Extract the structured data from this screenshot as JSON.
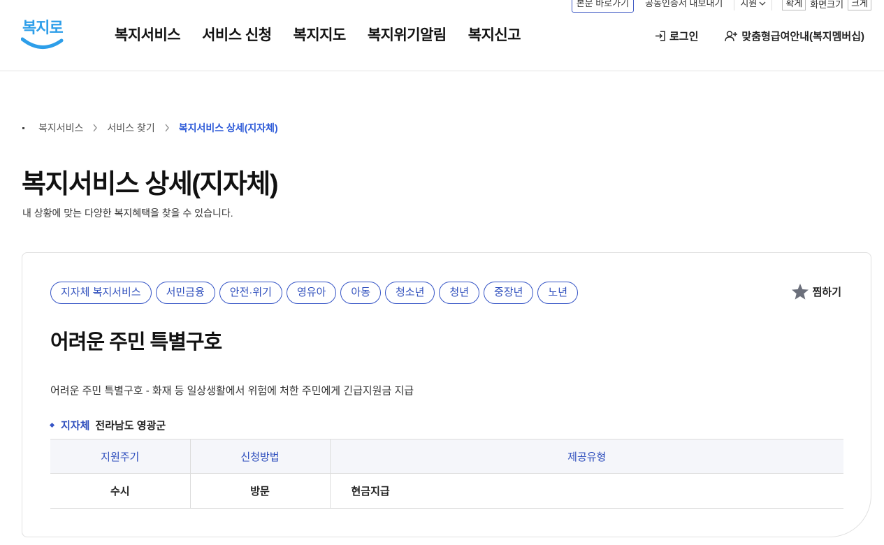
{
  "utility": {
    "skip_label": "본문 바로가기",
    "cert_label": "공동인증서 내보내기",
    "lang_label": "지원",
    "size_up": "확게",
    "size_label": "화면크기",
    "size_down": "크게"
  },
  "logo": {
    "text": "복지로",
    "color": "#2d9ee9"
  },
  "gnb": {
    "items": [
      "복지서비스",
      "서비스 신청",
      "복지지도",
      "복지위기알림",
      "복지신고"
    ]
  },
  "header_right": {
    "login_label": "로그인",
    "membership_label": "맞춤형급여안내(복지멤버십)"
  },
  "breadcrumb": {
    "items": [
      "복지서비스",
      "서비스 찾기"
    ],
    "current": "복지서비스 상세(지자체)"
  },
  "page": {
    "title": "복지서비스 상세(지자체)",
    "description": "내 상황에 맞는 다양한 복지혜택을 찾을 수 있습니다."
  },
  "card": {
    "tags": [
      "지자체 복지서비스",
      "서민금융",
      "안전·위기",
      "영유아",
      "아동",
      "청소년",
      "청년",
      "중장년",
      "노년"
    ],
    "bookmark_label": "찜하기",
    "title": "어려운 주민 특별구호",
    "description": "어려운 주민 특별구호 - 화재 등 일상생활에서 위험에 처한 주민에게 긴급지원금 지급",
    "region_label": "지자체",
    "region_value": "전라남도 영광군",
    "table": {
      "headers": [
        "지원주기",
        "신청방법",
        "제공유형"
      ],
      "row": [
        "수시",
        "방문",
        "현금지급"
      ]
    }
  },
  "colors": {
    "accent": "#2f4fbd",
    "brand": "#2d9ee9",
    "table_header_bg": "#f5f6fa"
  }
}
